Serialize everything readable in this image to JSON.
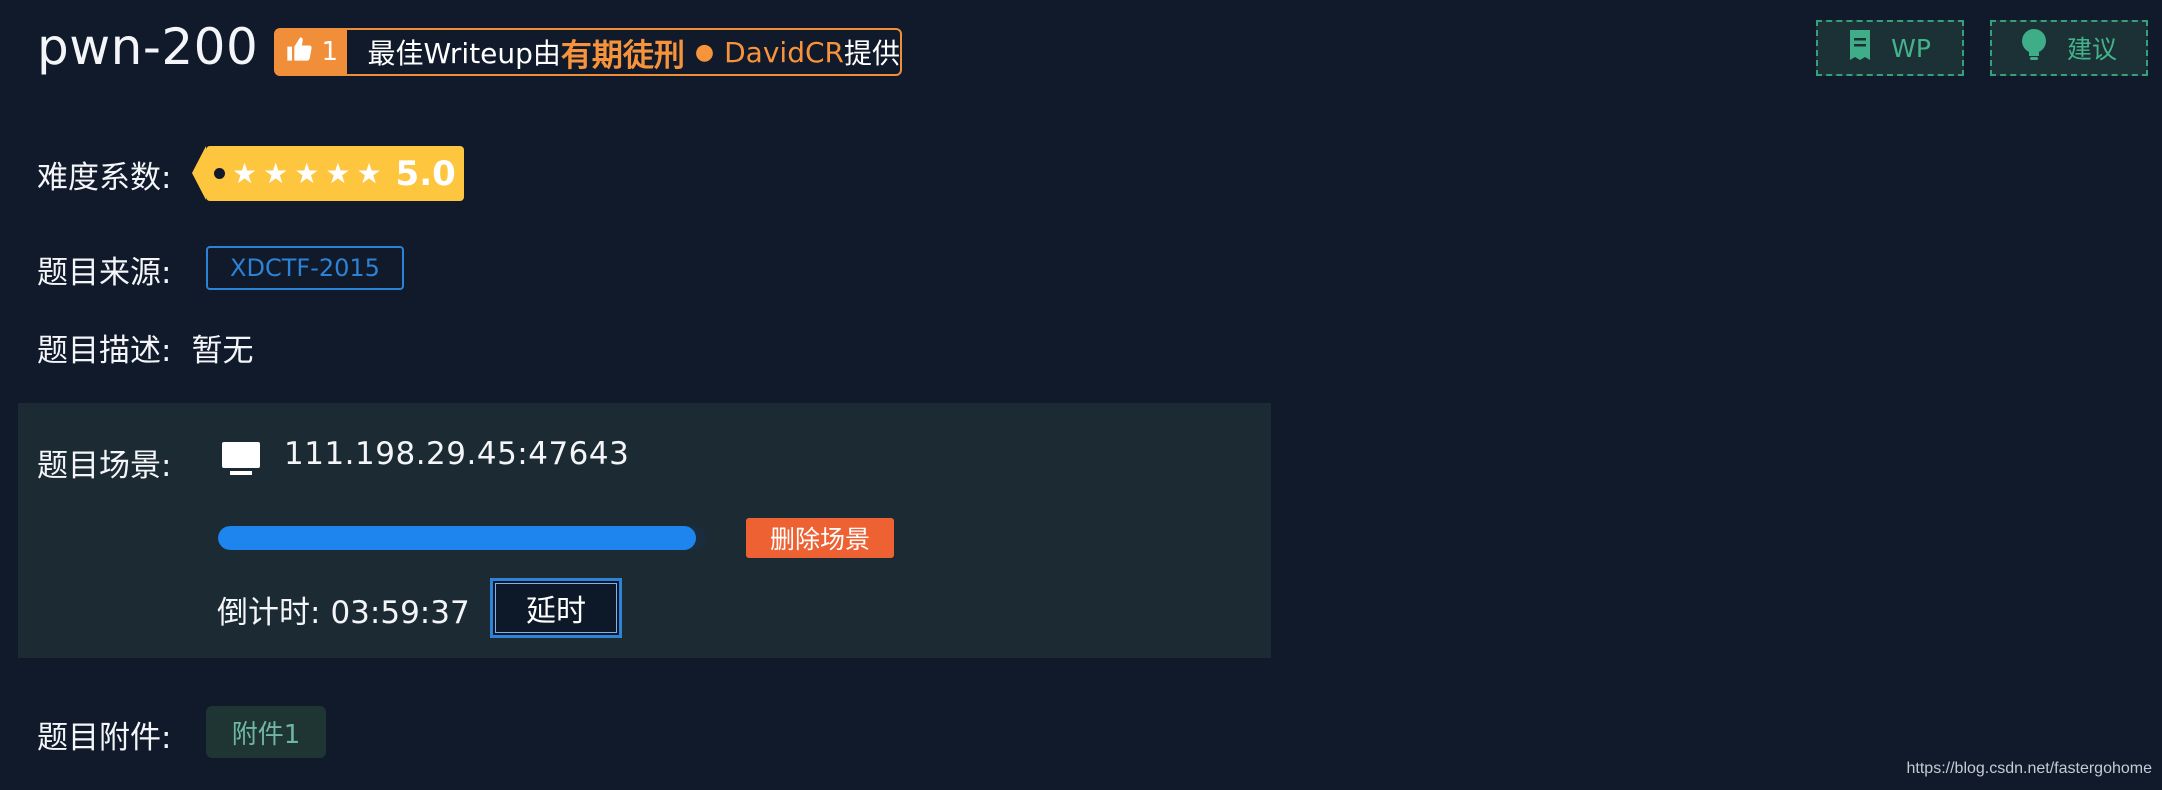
{
  "header": {
    "title": "pwn-200",
    "writeup": {
      "like_count": "1",
      "prefix": "最佳Writeup由",
      "team": "有期徒刑",
      "author": "DavidCR",
      "suffix": "提供"
    },
    "wp_button": "WP",
    "suggest_button": "建议",
    "icons": {
      "like": "thumbs-up-icon",
      "wp": "document-icon",
      "suggest": "lightbulb-icon"
    }
  },
  "difficulty": {
    "label": "难度系数:",
    "stars": 5,
    "max_stars": 5,
    "rating": "5.0"
  },
  "source": {
    "label": "题目来源:",
    "value": "XDCTF-2015"
  },
  "description": {
    "label": "题目描述:",
    "value": "暂无"
  },
  "scene": {
    "label": "题目场景:",
    "address": "111.198.29.45:47643",
    "progress": 0.98,
    "delete_button": "删除场景",
    "countdown_label": "倒计时:",
    "countdown_value": "03:59:37",
    "delay_button": "延时"
  },
  "attachment": {
    "label": "题目附件:",
    "file": "附件1"
  },
  "watermark": "https://blog.csdn.net/fastergohome",
  "colors": {
    "background": "#101a2a",
    "accent_orange": "#f08e3a",
    "accent_blue": "#1f85ee",
    "accent_green": "#34a07c",
    "danger": "#ee6133",
    "star_tag": "#fec53f"
  }
}
